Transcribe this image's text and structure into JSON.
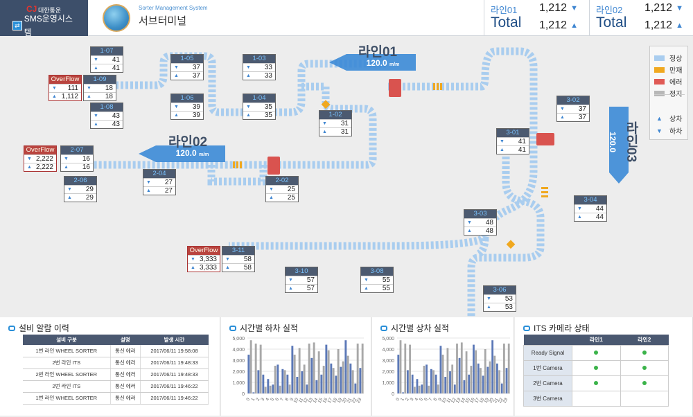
{
  "brand": {
    "corp": "대한통운",
    "cj": "CJ",
    "system": "SMS운영시스템",
    "subtitle": "Sorter Management System",
    "terminal": "서브터미널"
  },
  "totals": [
    {
      "label": "라인01",
      "value": "1,212",
      "total_label": "Total",
      "total_value": "1,212"
    },
    {
      "label": "라인02",
      "value": "1,212",
      "total_label": "Total",
      "total_value": "1,212"
    }
  ],
  "lines": [
    {
      "name": "라인01",
      "speed": "120.0",
      "unit": "m/m"
    },
    {
      "name": "라인02",
      "speed": "120.0",
      "unit": "m/m"
    },
    {
      "name": "라인03",
      "speed": "120.0",
      "unit": "m/m"
    }
  ],
  "legend": {
    "items": [
      "정상",
      "만재",
      "에러",
      "정지"
    ],
    "colors": [
      "#a9cdef",
      "#f0a81f",
      "#e05a55",
      "#b8b8b8"
    ],
    "dirs": [
      "상차",
      "하차"
    ]
  },
  "chutes": [
    {
      "id": "1-07",
      "a": "41",
      "b": "41"
    },
    {
      "id": "1-05",
      "a": "37",
      "b": "37"
    },
    {
      "id": "1-03",
      "a": "33",
      "b": "33"
    },
    {
      "id": "1-09",
      "a": "18",
      "b": "18"
    },
    {
      "id": "1-06",
      "a": "39",
      "b": "39"
    },
    {
      "id": "1-04",
      "a": "35",
      "b": "35"
    },
    {
      "id": "1-08",
      "a": "43",
      "b": "43"
    },
    {
      "id": "1-02",
      "a": "31",
      "b": "31"
    },
    {
      "id": "2-07",
      "a": "16",
      "b": "16"
    },
    {
      "id": "2-06",
      "a": "29",
      "b": "29"
    },
    {
      "id": "2-04",
      "a": "27",
      "b": "27"
    },
    {
      "id": "2-02",
      "a": "25",
      "b": "25"
    },
    {
      "id": "3-02",
      "a": "37",
      "b": "37"
    },
    {
      "id": "3-01",
      "a": "41",
      "b": "41"
    },
    {
      "id": "3-04",
      "a": "44",
      "b": "44"
    },
    {
      "id": "3-03",
      "a": "48",
      "b": "48"
    },
    {
      "id": "3-11",
      "a": "58",
      "b": "58"
    },
    {
      "id": "3-10",
      "a": "57",
      "b": "57"
    },
    {
      "id": "3-08",
      "a": "55",
      "b": "55"
    },
    {
      "id": "3-06",
      "a": "53",
      "b": "53"
    }
  ],
  "overflows": [
    {
      "label": "OverFlow",
      "a": "111",
      "b": "1,112"
    },
    {
      "label": "OverFlow",
      "a": "2,222",
      "b": "2,222"
    },
    {
      "label": "OverFlow",
      "a": "3,333",
      "b": "3,333"
    }
  ],
  "alarm": {
    "title": "설비 알람 이력",
    "headers": [
      "설비 구분",
      "설명",
      "발생 시간"
    ],
    "rows": [
      [
        "1번 라인 WHEEL SORTER",
        "통신 에러",
        "2017/06/11 19:58:08"
      ],
      [
        "2번 라인 ITS",
        "통신 에러",
        "2017/06/11 19:48:33"
      ],
      [
        "2번 라인 WHEEL SORTER",
        "통신 에러",
        "2017/06/11 19:48:33"
      ],
      [
        "2번 라인 ITS",
        "통신 에러",
        "2017/06/11 19:46:22"
      ],
      [
        "1번 라인 WHEEL SORTER",
        "통신 에러",
        "2017/06/11 19:46:22"
      ]
    ]
  },
  "chart_data": [
    {
      "type": "bar",
      "title": "시간별 하차 실적",
      "categories": [
        "0",
        "1",
        "2",
        "3",
        "4",
        "5",
        "6",
        "7",
        "8",
        "9",
        "10",
        "11",
        "12",
        "13",
        "14",
        "15",
        "16",
        "17",
        "18",
        "19",
        "20",
        "21",
        "22",
        "23"
      ],
      "ylim": [
        0,
        5000
      ],
      "yticks": [
        "0",
        "1,000",
        "2,000",
        "3,000",
        "4,000",
        "5,000"
      ],
      "series": [
        {
          "color": "#5b78b7",
          "values": [
            3500,
            100,
            2100,
            1700,
            1300,
            800,
            2600,
            2200,
            1700,
            4300,
            1500,
            2000,
            800,
            3200,
            1200,
            1700,
            4400,
            2700,
            1600,
            2400,
            4800,
            2700,
            900,
            2300
          ]
        },
        {
          "color": "#a8a8a8",
          "values": [
            4800,
            4500,
            4400,
            600,
            700,
            2500,
            700,
            2100,
            800,
            3500,
            4100,
            2600,
            4500,
            4600,
            3800,
            2500,
            3900,
            2300,
            4000,
            2900,
            3400,
            2100,
            4500,
            4500
          ]
        }
      ]
    },
    {
      "type": "bar",
      "title": "시간별 상차 실적",
      "categories": [
        "0",
        "1",
        "2",
        "3",
        "4",
        "5",
        "6",
        "7",
        "8",
        "9",
        "10",
        "11",
        "12",
        "13",
        "14",
        "15",
        "16",
        "17",
        "18",
        "19",
        "20",
        "21",
        "22",
        "23"
      ],
      "ylim": [
        0,
        5000
      ],
      "yticks": [
        "0",
        "1,000",
        "2,000",
        "3,000",
        "4,000",
        "5,000"
      ],
      "series": [
        {
          "color": "#5b78b7",
          "values": [
            3500,
            100,
            2100,
            1700,
            1300,
            800,
            2600,
            2200,
            1700,
            4300,
            1500,
            2000,
            800,
            3200,
            1200,
            1700,
            4400,
            2700,
            1600,
            2400,
            4800,
            2700,
            900,
            2300
          ]
        },
        {
          "color": "#a8a8a8",
          "values": [
            4800,
            4500,
            4400,
            600,
            700,
            2500,
            700,
            2100,
            800,
            3500,
            4100,
            2600,
            4500,
            4600,
            3800,
            2500,
            3900,
            2300,
            4000,
            2900,
            3400,
            2100,
            4500,
            4500
          ]
        }
      ]
    }
  ],
  "its": {
    "title": "ITS 카메라 상태",
    "cols": [
      "라인1",
      "라인2"
    ],
    "rows": [
      {
        "name": "Ready Signal",
        "l1": true,
        "l2": true
      },
      {
        "name": "1번 Camera",
        "l1": true,
        "l2": true
      },
      {
        "name": "2번 Camera",
        "l1": true,
        "l2": true
      },
      {
        "name": "3번 Camera",
        "l1": false,
        "l2": false
      }
    ]
  }
}
